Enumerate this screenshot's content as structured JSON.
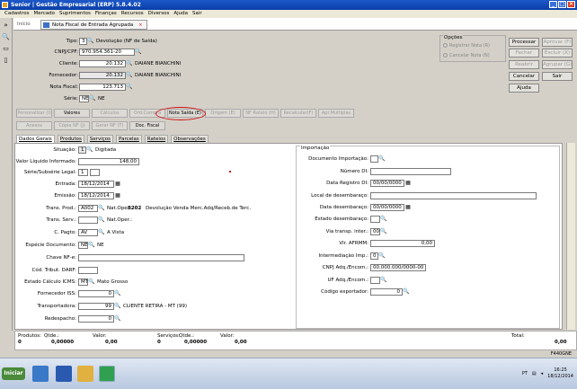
{
  "window": {
    "title": "Senior | Gestão Empresarial (ERP) 5.8.4.02"
  },
  "menu": [
    "Cadastros",
    "Mercado",
    "Suprimentos",
    "Finanças",
    "Recursos",
    "Diversos",
    "Ajuda",
    "Sair"
  ],
  "tabs": {
    "home": "Início",
    "doc": "Nota Fiscal de Entrada Agrupada"
  },
  "header": {
    "tipo_label": "Tipo:",
    "tipo_value": "3",
    "tipo_desc": "Devolução (NF de Saída)",
    "cnpj_label": "CNPJ/CPF:",
    "cnpj_value": "970.954.361-20",
    "cliente_label": "Cliente:",
    "cliente_value": "20.132",
    "cliente_name": "DAIANE BIANCHINI",
    "fornecedor_label": "Fornecedor:",
    "fornecedor_value": "20.132",
    "fornecedor_name": "DAIANE BIANCHINI",
    "nf_label": "Nota Fiscal:",
    "nf_value": "123.713",
    "serie_label": "Série:",
    "serie_value": "NE",
    "serie_desc": "NE"
  },
  "options": {
    "title": "Opções",
    "reg": "Registrar Nota (R)",
    "canc": "Cancelar Nota (N)"
  },
  "actions": [
    "Processar",
    "Aprovar (F)",
    "Fechar",
    "Excluir (X)",
    "Reabrir",
    "Agrupar (G)",
    "Cancelar",
    "Sair",
    "Ajuda"
  ],
  "toolbar_row1": [
    "Personalizar (I)",
    "Valores",
    "Cálculos",
    "Ord.Compra",
    "Nota Saída (E)",
    "Origem (E)",
    "NF Rateio (H)",
    "Recalcular(F)",
    "Apr.Multiplas"
  ],
  "toolbar_row2": [
    "Anexos",
    "Cópia NF (J)",
    "Gerar NF (T)",
    "Doc. Fiscal"
  ],
  "subtabs": [
    "Dados Gerais",
    "Produtos",
    "Serviços",
    "Parcelas",
    "Rateios",
    "Observações"
  ],
  "gerais": {
    "situacao_label": "Situação:",
    "situacao_value": "1",
    "situacao_desc": "Digitada",
    "valor_label": "Valor Líquido Informado:",
    "valor_value": "148,00",
    "serie_sub_label": "Série/Subsérie Legal:",
    "serie_sub_value": "1",
    "entrada_label": "Entrada:",
    "entrada_value": "18/12/2014",
    "emissao_label": "Emissão:",
    "emissao_value": "18/12/2014",
    "transprod_label": "Trans. Prod.:",
    "transprod_value": "A002",
    "natoper_label": "Nat.Oper.:",
    "natoper_value": "3202",
    "natoper_desc": "Devolução Venda Merc.Adq/Receb.de Terc.",
    "transserv_label": "Trans. Serv.:",
    "natoper2_label": "Nat.Oper.:",
    "cpagto_label": "C. Pagto:",
    "cpagto_value": "AV",
    "cpagto_desc": "A Vista",
    "especie_label": "Espécie Documento:",
    "especie_value": "NE",
    "especie_desc": "NE",
    "chave_label": "Chave NF-e:",
    "codtrib_label": "Cód. Tribut. DARF:",
    "estado_label": "Estado Cálculo ICMS:",
    "estado_value": "MT",
    "estado_desc": "Mato Grosso",
    "fornecedor_iss_label": "Fornecedor ISS:",
    "fornecedor_iss_value": "0",
    "transportadora_label": "Transportadora:",
    "transportadora_value": "99",
    "transportadora_desc": "CLIENTE RETIRA - MT (99)",
    "redespacho_label": "Redespacho:",
    "redespacho_value": "0"
  },
  "importacao": {
    "title": "Importação",
    "docimp_label": "Documento Importação:",
    "numdi_label": "Número DI:",
    "dataregdi_label": "Data Registro DI:",
    "dataregdi_value": "00/00/0000",
    "localdes_label": "Local de desembaraço:",
    "datades_label": "Data desembaraço:",
    "datades_value": "00/00/0000",
    "estadodes_label": "Estado desembaraço:",
    "viatransp_label": "Via transp. inter.:",
    "viatransp_value": "00",
    "vlrafrmm_label": "Vlr. AFRMM:",
    "vlrafrmm_value": "0,00",
    "intermed_label": "Intermediação Imp.:",
    "intermed_value": "0",
    "cnpjadq_label": "CNPJ Adq./Encom.:",
    "cnpjadq_value": "00.000.000/0000-00",
    "ufadq_label": "UF Adq./Encom.:",
    "codexp_label": "Código exportador:",
    "codexp_value": "0"
  },
  "footer": {
    "produtos_label": "Produtos:",
    "qtde_label": "Qtde.:",
    "valor_label": "Valor:",
    "servicos_label": "Serviços:",
    "total_label": "Total:",
    "prod_count": "0",
    "prod_qtde": "0,00000",
    "prod_valor": "0,00",
    "serv_count": "0",
    "serv_qtde": "0,00000",
    "serv_valor": "0,00",
    "total_value": "0,00"
  },
  "status": "F440GNE",
  "taskbar": {
    "start": "Iniciar",
    "lang": "PT",
    "time": "16:25",
    "date": "18/12/2014"
  }
}
